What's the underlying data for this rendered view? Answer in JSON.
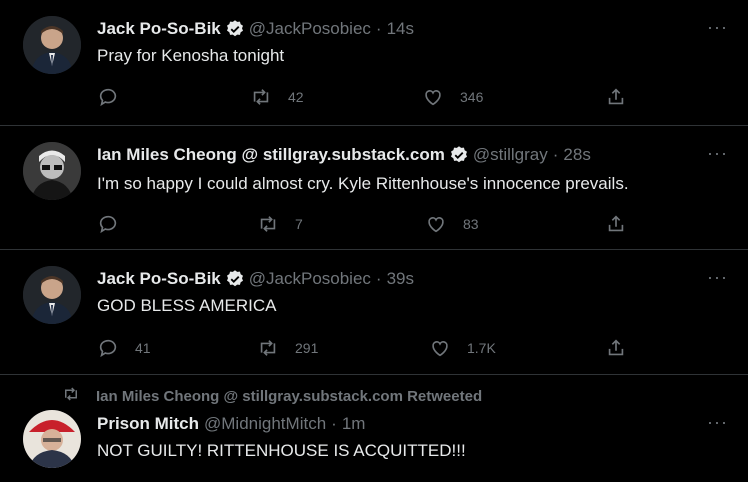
{
  "tweets": [
    {
      "name": "Jack Po-So-Bik",
      "handle": "@JackPosobiec",
      "time": "14s",
      "text": "Pray for Kenosha tonight",
      "reply_count": "",
      "retweet_count": "42",
      "like_count": "346"
    },
    {
      "name": "Ian Miles Cheong @ stillgray.substack.com",
      "handle": "@stillgray",
      "time": "28s",
      "text": "I'm so happy I could almost cry. Kyle Rittenhouse's innocence prevails.",
      "reply_count": "",
      "retweet_count": "7",
      "like_count": "83"
    },
    {
      "name": "Jack Po-So-Bik",
      "handle": "@JackPosobiec",
      "time": "39s",
      "text": "GOD BLESS AMERICA",
      "reply_count": "41",
      "retweet_count": "291",
      "like_count": "1.7K"
    },
    {
      "retweeted_by": "Ian Miles Cheong @ stillgray.substack.com Retweeted",
      "name": "Prison Mitch",
      "handle": "@MidnightMitch",
      "time": "1m",
      "text": "NOT GUILTY! RITTENHOUSE IS ACQUITTED!!!"
    }
  ],
  "ui": {
    "separator": "·",
    "more_glyph": "···"
  },
  "colors": {
    "background": "#000000",
    "text": "#e7e9ea",
    "muted": "#71767b",
    "verified": "#1d9bf0",
    "border": "#2f3336"
  },
  "icons": [
    "reply-icon",
    "retweet-icon",
    "like-icon",
    "share-icon",
    "verified-badge-icon",
    "more-icon"
  ]
}
